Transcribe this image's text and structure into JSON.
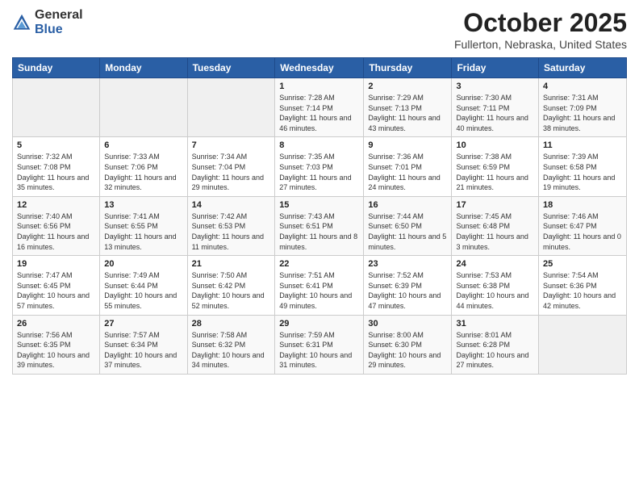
{
  "header": {
    "logo_general": "General",
    "logo_blue": "Blue",
    "month": "October 2025",
    "location": "Fullerton, Nebraska, United States"
  },
  "days_of_week": [
    "Sunday",
    "Monday",
    "Tuesday",
    "Wednesday",
    "Thursday",
    "Friday",
    "Saturday"
  ],
  "weeks": [
    [
      {
        "day": "",
        "info": ""
      },
      {
        "day": "",
        "info": ""
      },
      {
        "day": "",
        "info": ""
      },
      {
        "day": "1",
        "info": "Sunrise: 7:28 AM\nSunset: 7:14 PM\nDaylight: 11 hours and 46 minutes."
      },
      {
        "day": "2",
        "info": "Sunrise: 7:29 AM\nSunset: 7:13 PM\nDaylight: 11 hours and 43 minutes."
      },
      {
        "day": "3",
        "info": "Sunrise: 7:30 AM\nSunset: 7:11 PM\nDaylight: 11 hours and 40 minutes."
      },
      {
        "day": "4",
        "info": "Sunrise: 7:31 AM\nSunset: 7:09 PM\nDaylight: 11 hours and 38 minutes."
      }
    ],
    [
      {
        "day": "5",
        "info": "Sunrise: 7:32 AM\nSunset: 7:08 PM\nDaylight: 11 hours and 35 minutes."
      },
      {
        "day": "6",
        "info": "Sunrise: 7:33 AM\nSunset: 7:06 PM\nDaylight: 11 hours and 32 minutes."
      },
      {
        "day": "7",
        "info": "Sunrise: 7:34 AM\nSunset: 7:04 PM\nDaylight: 11 hours and 29 minutes."
      },
      {
        "day": "8",
        "info": "Sunrise: 7:35 AM\nSunset: 7:03 PM\nDaylight: 11 hours and 27 minutes."
      },
      {
        "day": "9",
        "info": "Sunrise: 7:36 AM\nSunset: 7:01 PM\nDaylight: 11 hours and 24 minutes."
      },
      {
        "day": "10",
        "info": "Sunrise: 7:38 AM\nSunset: 6:59 PM\nDaylight: 11 hours and 21 minutes."
      },
      {
        "day": "11",
        "info": "Sunrise: 7:39 AM\nSunset: 6:58 PM\nDaylight: 11 hours and 19 minutes."
      }
    ],
    [
      {
        "day": "12",
        "info": "Sunrise: 7:40 AM\nSunset: 6:56 PM\nDaylight: 11 hours and 16 minutes."
      },
      {
        "day": "13",
        "info": "Sunrise: 7:41 AM\nSunset: 6:55 PM\nDaylight: 11 hours and 13 minutes."
      },
      {
        "day": "14",
        "info": "Sunrise: 7:42 AM\nSunset: 6:53 PM\nDaylight: 11 hours and 11 minutes."
      },
      {
        "day": "15",
        "info": "Sunrise: 7:43 AM\nSunset: 6:51 PM\nDaylight: 11 hours and 8 minutes."
      },
      {
        "day": "16",
        "info": "Sunrise: 7:44 AM\nSunset: 6:50 PM\nDaylight: 11 hours and 5 minutes."
      },
      {
        "day": "17",
        "info": "Sunrise: 7:45 AM\nSunset: 6:48 PM\nDaylight: 11 hours and 3 minutes."
      },
      {
        "day": "18",
        "info": "Sunrise: 7:46 AM\nSunset: 6:47 PM\nDaylight: 11 hours and 0 minutes."
      }
    ],
    [
      {
        "day": "19",
        "info": "Sunrise: 7:47 AM\nSunset: 6:45 PM\nDaylight: 10 hours and 57 minutes."
      },
      {
        "day": "20",
        "info": "Sunrise: 7:49 AM\nSunset: 6:44 PM\nDaylight: 10 hours and 55 minutes."
      },
      {
        "day": "21",
        "info": "Sunrise: 7:50 AM\nSunset: 6:42 PM\nDaylight: 10 hours and 52 minutes."
      },
      {
        "day": "22",
        "info": "Sunrise: 7:51 AM\nSunset: 6:41 PM\nDaylight: 10 hours and 49 minutes."
      },
      {
        "day": "23",
        "info": "Sunrise: 7:52 AM\nSunset: 6:39 PM\nDaylight: 10 hours and 47 minutes."
      },
      {
        "day": "24",
        "info": "Sunrise: 7:53 AM\nSunset: 6:38 PM\nDaylight: 10 hours and 44 minutes."
      },
      {
        "day": "25",
        "info": "Sunrise: 7:54 AM\nSunset: 6:36 PM\nDaylight: 10 hours and 42 minutes."
      }
    ],
    [
      {
        "day": "26",
        "info": "Sunrise: 7:56 AM\nSunset: 6:35 PM\nDaylight: 10 hours and 39 minutes."
      },
      {
        "day": "27",
        "info": "Sunrise: 7:57 AM\nSunset: 6:34 PM\nDaylight: 10 hours and 37 minutes."
      },
      {
        "day": "28",
        "info": "Sunrise: 7:58 AM\nSunset: 6:32 PM\nDaylight: 10 hours and 34 minutes."
      },
      {
        "day": "29",
        "info": "Sunrise: 7:59 AM\nSunset: 6:31 PM\nDaylight: 10 hours and 31 minutes."
      },
      {
        "day": "30",
        "info": "Sunrise: 8:00 AM\nSunset: 6:30 PM\nDaylight: 10 hours and 29 minutes."
      },
      {
        "day": "31",
        "info": "Sunrise: 8:01 AM\nSunset: 6:28 PM\nDaylight: 10 hours and 27 minutes."
      },
      {
        "day": "",
        "info": ""
      }
    ]
  ]
}
